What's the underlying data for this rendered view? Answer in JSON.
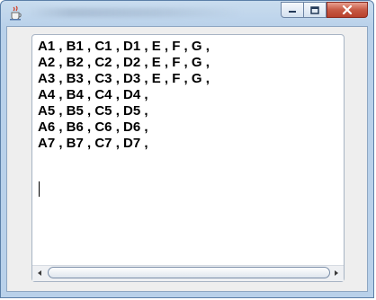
{
  "window": {
    "icons": {
      "app": "java-cup-icon",
      "minimize": "minimize-icon",
      "maximize": "maximize-icon",
      "close": "close-icon"
    },
    "colors": {
      "frame": "#b9d1ea",
      "close": "#c75a45",
      "text": "#000000"
    }
  },
  "textarea": {
    "lines": [
      "A1 , B1 , C1 , D1 , E , F , G ,",
      "A2 , B2 , C2 , D2 , E , F , G ,",
      "A3 , B3 , C3 , D3 , E , F , G ,",
      "A4 , B4 , C4 , D4 ,",
      "A5 , B5 , C5 , D5 ,",
      "A6 , B6 , C6 , D6 ,",
      "A7 , B7 , C7 , D7 ,"
    ]
  },
  "scrollbar": {
    "left_arrow": "arrow-left-icon",
    "right_arrow": "arrow-right-icon"
  }
}
